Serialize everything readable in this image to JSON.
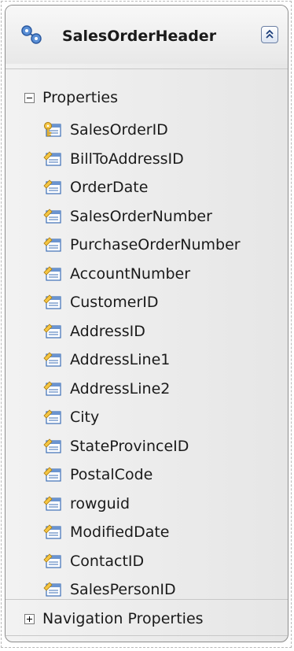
{
  "entity": {
    "title": "SalesOrderHeader",
    "entity_icon": "entity-type-icon",
    "collapse_icon": "collapse-chevrons-up-icon"
  },
  "sections": {
    "properties": {
      "label": "Properties",
      "expanded": true,
      "expander_icon": "minus-expander-icon"
    },
    "navigation": {
      "label": "Navigation Properties",
      "expanded": false,
      "expander_icon": "plus-expander-icon"
    }
  },
  "properties": [
    {
      "name": "SalesOrderID",
      "icon": "key-property-icon"
    },
    {
      "name": "BillToAddressID",
      "icon": "property-icon"
    },
    {
      "name": "OrderDate",
      "icon": "property-icon"
    },
    {
      "name": "SalesOrderNumber",
      "icon": "property-icon"
    },
    {
      "name": "PurchaseOrderNumber",
      "icon": "property-icon"
    },
    {
      "name": "AccountNumber",
      "icon": "property-icon"
    },
    {
      "name": "CustomerID",
      "icon": "property-icon"
    },
    {
      "name": "AddressID",
      "icon": "property-icon"
    },
    {
      "name": "AddressLine1",
      "icon": "property-icon"
    },
    {
      "name": "AddressLine2",
      "icon": "property-icon"
    },
    {
      "name": "City",
      "icon": "property-icon"
    },
    {
      "name": "StateProvinceID",
      "icon": "property-icon"
    },
    {
      "name": "PostalCode",
      "icon": "property-icon"
    },
    {
      "name": "rowguid",
      "icon": "property-icon"
    },
    {
      "name": "ModifiedDate",
      "icon": "property-icon"
    },
    {
      "name": "ContactID",
      "icon": "property-icon"
    },
    {
      "name": "SalesPersonID",
      "icon": "property-icon"
    }
  ],
  "colors": {
    "icon_yellow": "#f5c542",
    "icon_blue": "#3d6fb6",
    "border": "#8c8c8c"
  }
}
